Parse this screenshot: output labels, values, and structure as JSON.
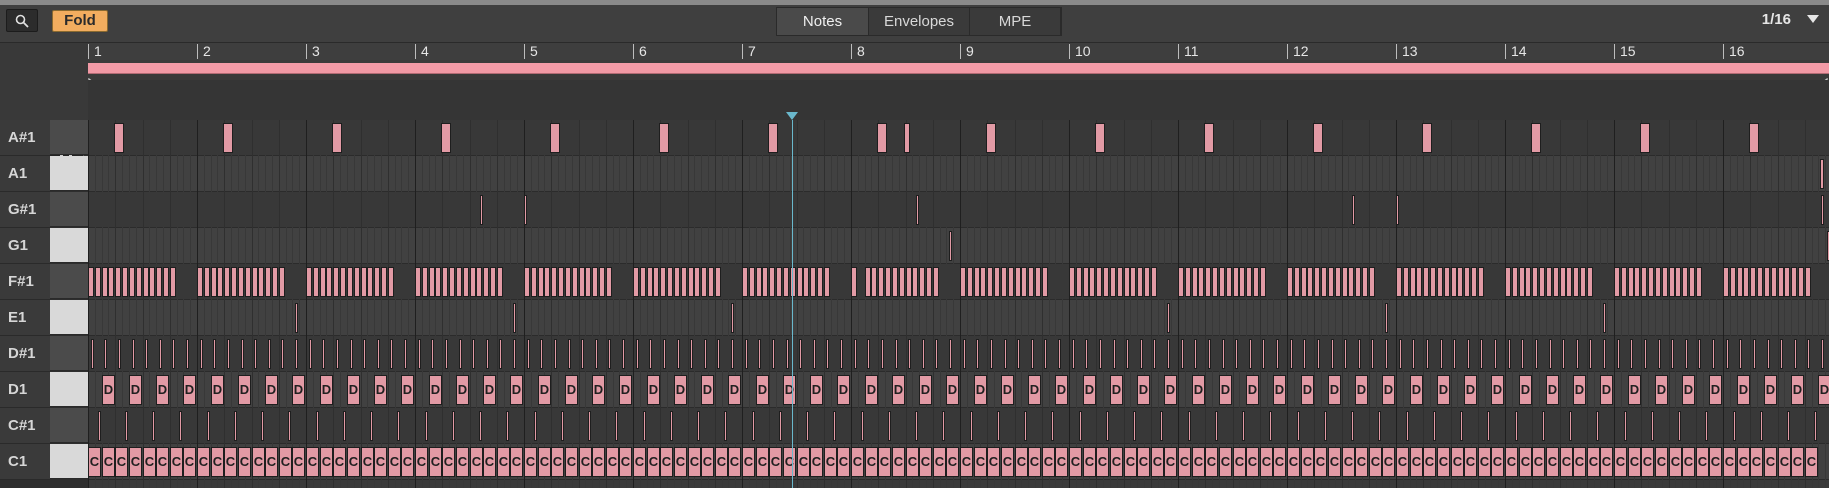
{
  "toolbar": {
    "fold_label": "Fold",
    "tabs": [
      "Notes",
      "Envelopes",
      "MPE"
    ],
    "active_tab": "Notes",
    "grid_value": "1/16"
  },
  "ruler": {
    "bars": [
      "1",
      "2",
      "3",
      "4",
      "5",
      "6",
      "7",
      "8",
      "9",
      "10",
      "11",
      "12",
      "13",
      "14",
      "15",
      "16"
    ]
  },
  "keys": [
    "A#1",
    "A1",
    "G#1",
    "G1",
    "F#1",
    "E1",
    "D#1",
    "D1",
    "C#1",
    "C1"
  ],
  "colors": {
    "note_fill": "#e29aa5",
    "loop_bar": "#f29aa6",
    "fold_button": "#f2ad5f",
    "playhead": "#6ab8cc"
  },
  "note_letters": {
    "D1": "D",
    "C1": "C"
  }
}
